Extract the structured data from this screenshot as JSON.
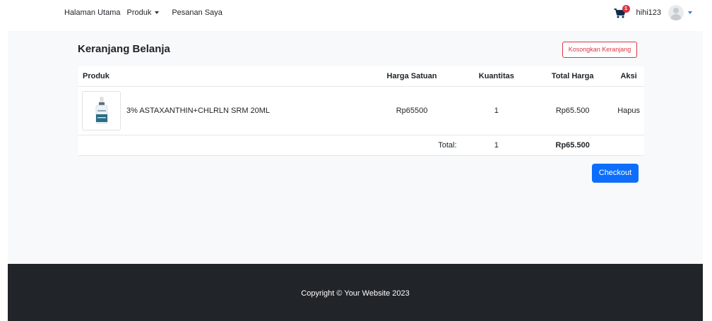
{
  "navbar": {
    "links": [
      "Halaman Utama",
      "Produk",
      "Pesanan Saya"
    ],
    "cart_count": "1",
    "username": "hihi123",
    "colors": {
      "badge": "#dc3545",
      "user_caret": "#2b7de9"
    }
  },
  "page": {
    "title": "Keranjang Belanja",
    "empty_cart_label": "Kosongkan Keranjang"
  },
  "table": {
    "headers": {
      "product": "Produk",
      "unit_price": "Harga Satuan",
      "quantity": "Kuantitas",
      "total_price": "Total Harga",
      "action": "Aksi"
    },
    "items": [
      {
        "name": "3% ASTAXANTHIN+CHLRLN SRM 20ML",
        "unit_price": "Rp65500",
        "quantity": "1",
        "total_price": "Rp65.500",
        "action": "Hapus",
        "thumbnail_icon": "product-bottle-icon"
      }
    ],
    "summary": {
      "label": "Total:",
      "quantity": "1",
      "total_price": "Rp65.500"
    }
  },
  "checkout_label": "Checkout",
  "footer": {
    "copyright": "Copyright © Your Website 2023"
  },
  "colors": {
    "primary": "#0d6efd",
    "danger": "#dc3545",
    "footer_bg": "#212529",
    "content_bg": "#f8f9fa"
  }
}
